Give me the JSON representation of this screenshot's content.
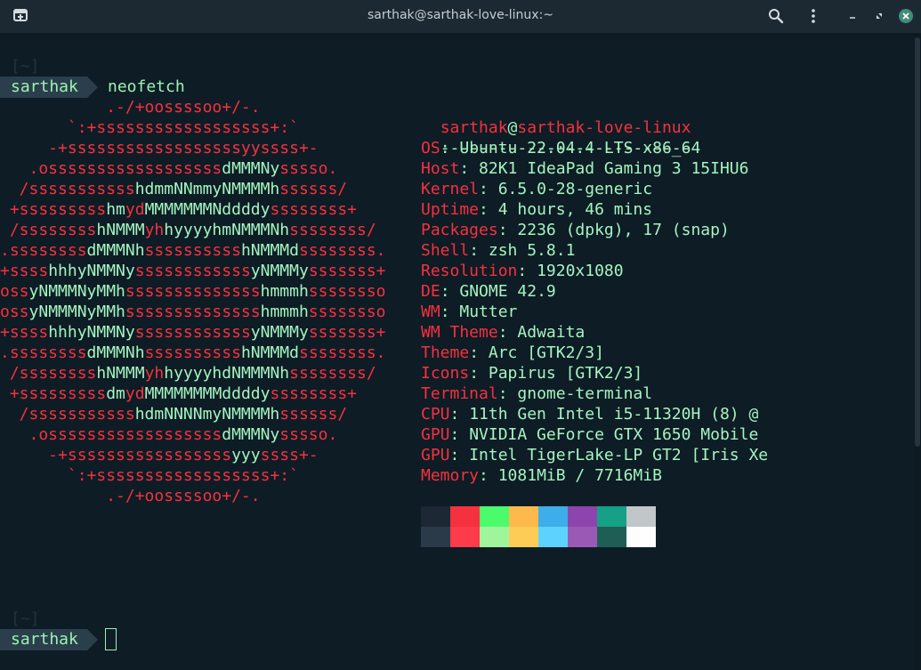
{
  "window": {
    "title": "sarthak@sarthak-love-linux:~",
    "buttons": [
      "new-tab-icon",
      "search-icon",
      "menu-icon",
      "minimize-icon",
      "restore-icon",
      "close-icon"
    ]
  },
  "prompt1": {
    "dir": "[~]",
    "user": "sarthak",
    "command": "neofetch"
  },
  "prompt2": {
    "dir": "[~]",
    "user": "sarthak"
  },
  "logo_lines": [
    [
      [
        "r",
        "           .-/+oossssoo+/-.           "
      ]
    ],
    [
      [
        "r",
        "       `:+ssssssssssssssssss+:`       "
      ]
    ],
    [
      [
        "r",
        "     -+ssssssssssssssssssyyssss+-     "
      ]
    ],
    [
      [
        "r",
        "   .ossssssssssssssssss"
      ],
      [
        "g",
        "dMMMNy"
      ],
      [
        "r",
        "sssso.   "
      ]
    ],
    [
      [
        "r",
        "  /sssssssssss"
      ],
      [
        "g",
        "hdmmNNmmyNMMMMh"
      ],
      [
        "r",
        "ssssss/  "
      ]
    ],
    [
      [
        "r",
        " +sssssssss"
      ],
      [
        "g",
        "hm"
      ],
      [
        "r",
        "yd"
      ],
      [
        "g",
        "MMMMMMMNddddy"
      ],
      [
        "r",
        "ssssssss+ "
      ]
    ],
    [
      [
        "r",
        " /ssssssss"
      ],
      [
        "g",
        "hNMMM"
      ],
      [
        "r",
        "yh"
      ],
      [
        "g",
        "hyyyyhmNMMMNh"
      ],
      [
        "r",
        "ssssssss/ "
      ]
    ],
    [
      [
        "r",
        ".ssssssss"
      ],
      [
        "g",
        "dMMMNh"
      ],
      [
        "r",
        "ssssssssss"
      ],
      [
        "g",
        "hNMMMd"
      ],
      [
        "r",
        "ssssssss."
      ]
    ],
    [
      [
        "r",
        "+ssss"
      ],
      [
        "g",
        "hhhyNMMNy"
      ],
      [
        "r",
        "ssssssssssss"
      ],
      [
        "g",
        "yNMMMy"
      ],
      [
        "r",
        "sssssss+"
      ]
    ],
    [
      [
        "r",
        "oss"
      ],
      [
        "g",
        "yNMMMNyMMh"
      ],
      [
        "r",
        "ssssssssssssss"
      ],
      [
        "g",
        "hmmmh"
      ],
      [
        "r",
        "ssssssso"
      ]
    ],
    [
      [
        "r",
        "oss"
      ],
      [
        "g",
        "yNMMMNyMMh"
      ],
      [
        "r",
        "ssssssssssssss"
      ],
      [
        "g",
        "hmmmh"
      ],
      [
        "r",
        "ssssssso"
      ]
    ],
    [
      [
        "r",
        "+ssss"
      ],
      [
        "g",
        "hhhyNMMNy"
      ],
      [
        "r",
        "ssssssssssss"
      ],
      [
        "g",
        "yNMMMy"
      ],
      [
        "r",
        "sssssss+"
      ]
    ],
    [
      [
        "r",
        ".ssssssss"
      ],
      [
        "g",
        "dMMMNh"
      ],
      [
        "r",
        "ssssssssss"
      ],
      [
        "g",
        "hNMMMd"
      ],
      [
        "r",
        "ssssssss."
      ]
    ],
    [
      [
        "r",
        " /ssssssss"
      ],
      [
        "g",
        "hNMMM"
      ],
      [
        "r",
        "yh"
      ],
      [
        "g",
        "hyyyyhdNMMMNh"
      ],
      [
        "r",
        "ssssssss/ "
      ]
    ],
    [
      [
        "r",
        " +sssssssss"
      ],
      [
        "g",
        "dm"
      ],
      [
        "r",
        "yd"
      ],
      [
        "g",
        "MMMMMMMMddddy"
      ],
      [
        "r",
        "ssssssss+ "
      ]
    ],
    [
      [
        "r",
        "  /sssssssssss"
      ],
      [
        "g",
        "hdmNNNNmyNMMMMh"
      ],
      [
        "r",
        "ssssss/  "
      ]
    ],
    [
      [
        "r",
        "   .ossssssssssssssssss"
      ],
      [
        "g",
        "dMMMNy"
      ],
      [
        "r",
        "sssso.   "
      ]
    ],
    [
      [
        "r",
        "     -+sssssssssssssssss"
      ],
      [
        "g",
        "yyy"
      ],
      [
        "r",
        "ssss+-     "
      ]
    ],
    [
      [
        "r",
        "       `:+ssssssssssssssssss+:`       "
      ]
    ],
    [
      [
        "r",
        "           .-/+oossssoo+/-.           "
      ]
    ]
  ],
  "info_header": {
    "user": "sarthak",
    "at": "@",
    "host": "sarthak-love-linux",
    "separator": "--------------------------"
  },
  "info": [
    {
      "key": "OS",
      "value": "Ubuntu 22.04.4 LTS x86_64"
    },
    {
      "key": "Host",
      "value": "82K1 IdeaPad Gaming 3 15IHU6"
    },
    {
      "key": "Kernel",
      "value": "6.5.0-28-generic"
    },
    {
      "key": "Uptime",
      "value": "4 hours, 46 mins"
    },
    {
      "key": "Packages",
      "value": "2236 (dpkg), 17 (snap)"
    },
    {
      "key": "Shell",
      "value": "zsh 5.8.1"
    },
    {
      "key": "Resolution",
      "value": "1920x1080"
    },
    {
      "key": "DE",
      "value": "GNOME 42.9"
    },
    {
      "key": "WM",
      "value": "Mutter"
    },
    {
      "key": "WM Theme",
      "value": "Adwaita"
    },
    {
      "key": "Theme",
      "value": "Arc [GTK2/3]"
    },
    {
      "key": "Icons",
      "value": "Papirus [GTK2/3]"
    },
    {
      "key": "Terminal",
      "value": "gnome-terminal"
    },
    {
      "key": "CPU",
      "value": "11th Gen Intel i5-11320H (8) @"
    },
    {
      "key": "GPU",
      "value": "NVIDIA GeForce GTX 1650 Mobile"
    },
    {
      "key": "GPU",
      "value": "Intel TigerLake-LP GT2 [Iris Xe"
    },
    {
      "key": "Memory",
      "value": "1081MiB / 7716MiB"
    }
  ],
  "palette": {
    "normal": [
      "#1c2833",
      "#f5313f",
      "#4cfb6b",
      "#fdb94c",
      "#3daee9",
      "#8e44ad",
      "#16a085",
      "#c1c6c9"
    ],
    "bright": [
      "#2b3a49",
      "#fe3b4a",
      "#a0f59c",
      "#fdcc56",
      "#5ed2fe",
      "#9b59b6",
      "#1f5e55",
      "#fefefe"
    ]
  }
}
